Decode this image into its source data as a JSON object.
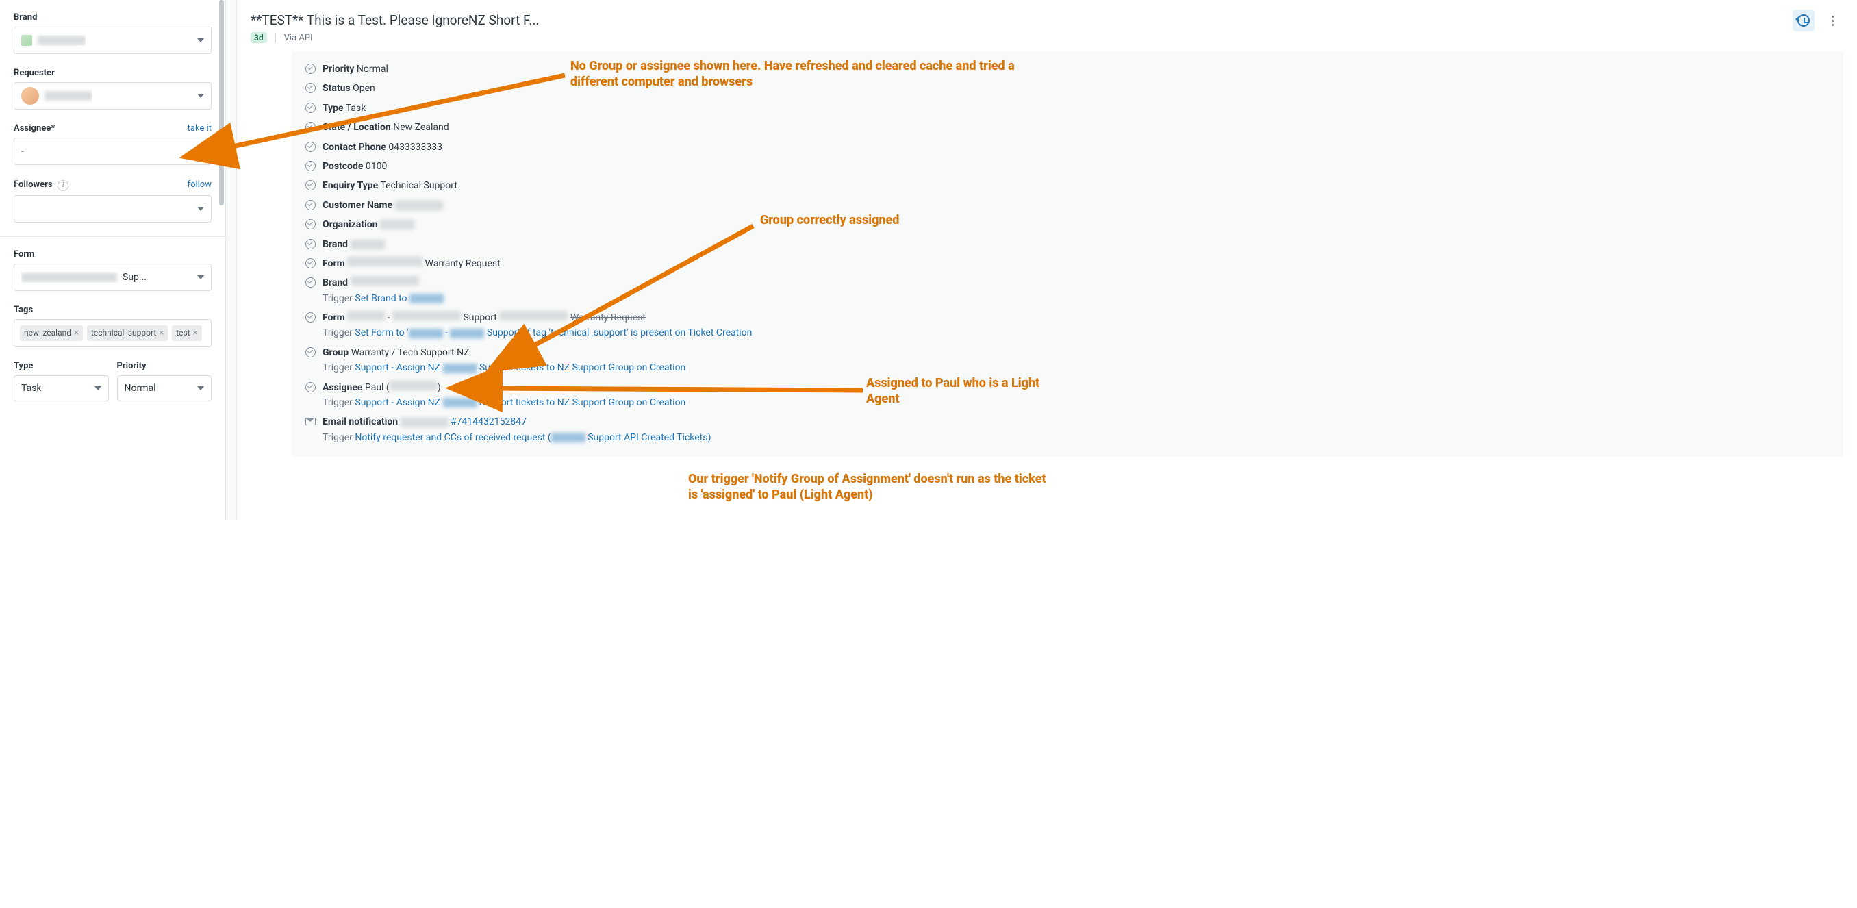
{
  "sidebar": {
    "brand_label": "Brand",
    "requester_label": "Requester",
    "assignee_label": "Assignee*",
    "assignee_action": "take it",
    "assignee_value": "-",
    "followers_label": "Followers",
    "followers_action": "follow",
    "form_label": "Form",
    "form_suffix": "Sup...",
    "tags_label": "Tags",
    "tags": [
      "new_zealand",
      "technical_support",
      "test"
    ],
    "type_label": "Type",
    "type_value": "Task",
    "priority_label": "Priority",
    "priority_value": "Normal"
  },
  "header": {
    "title": "**TEST** This is a Test. Please IgnoreNZ Short F...",
    "age": "3d",
    "via": "Via API"
  },
  "events": {
    "priority_label": "Priority",
    "priority_value": "Normal",
    "status_label": "Status",
    "status_value": "Open",
    "type_label": "Type",
    "type_value": "Task",
    "state_label": "State / Location",
    "state_value": "New Zealand",
    "phone_label": "Contact Phone",
    "phone_value": "0433333333",
    "postcode_label": "Postcode",
    "postcode_value": "0100",
    "enquiry_label": "Enquiry Type",
    "enquiry_value": "Technical Support",
    "customer_label": "Customer Name",
    "org_label": "Organization",
    "brand_label": "Brand",
    "form_label": "Form",
    "form_suffix": "Warranty Request",
    "brand2_label": "Brand",
    "brand2_trigger_prefix": "Set Brand to ",
    "form2_label": "Form",
    "form2_mid": " Support ",
    "form2_end": "Warranty Request",
    "form2_trigger": "Set Form to '",
    "form2_trigger_end": " Support' if tag 'technical_support' is present on Ticket Creation",
    "group_label": "Group",
    "group_value": "Warranty / Tech Support NZ",
    "group_trigger_a": "Support - Assign NZ ",
    "group_trigger_b": " Support tickets to NZ Support Group on Creation",
    "assignee_label": "Assignee",
    "assignee_value_a": "Paul (",
    "assignee_value_b": ")",
    "assignee_trigger_a": "Support - Assign NZ ",
    "assignee_trigger_b": " Support tickets to NZ Support Group on Creation",
    "email_label": "Email notification",
    "email_ticket": "#7414432152847",
    "email_trigger_a": "Notify requester and CCs of received request (",
    "email_trigger_b": " Support API Created Tickets)",
    "trigger_word": "Trigger"
  },
  "annotations": {
    "a1": "No Group or assignee shown here. Have refreshed and cleared cache and tried a different computer and browsers",
    "a2": "Group correctly assigned",
    "a3": "Assigned to Paul who is a Light Agent",
    "a4": "Our trigger 'Notify Group of Assignment' doesn't run as the ticket is 'assigned' to Paul (Light Agent)"
  }
}
